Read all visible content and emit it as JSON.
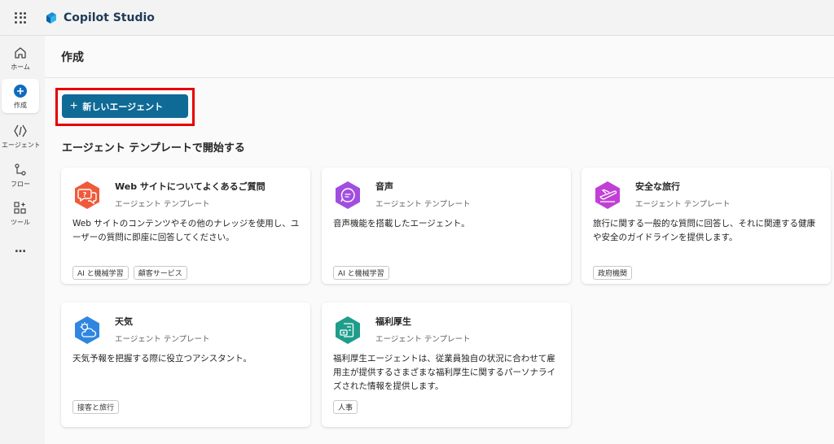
{
  "app": {
    "title": "Copilot Studio"
  },
  "rail": {
    "items": [
      {
        "label": "ホーム",
        "icon": "home-icon"
      },
      {
        "label": "作成",
        "icon": "create-plus-icon",
        "active": true
      },
      {
        "label": "エージェント",
        "icon": "agents-icon"
      },
      {
        "label": "フロー",
        "icon": "flow-icon"
      },
      {
        "label": "ツール",
        "icon": "tools-icon"
      },
      {
        "label": "…",
        "icon": "more-icon"
      }
    ]
  },
  "page": {
    "title": "作成"
  },
  "new_agent_button": {
    "label": "新しいエージェント"
  },
  "section": {
    "title": "エージェント テンプレートで開始する"
  },
  "templates": [
    {
      "title": "Web サイトについてよくあるご質問",
      "subtitle": "エージェント テンプレート",
      "description": "Web サイトのコンテンツやその他のナレッジを使用し、ユーザーの質問に即座に回答してください。",
      "tags": [
        "AI と機械学習",
        "顧客サービス"
      ],
      "icon": "faq-chat-icon",
      "color": "#ef5a3a"
    },
    {
      "title": "音声",
      "subtitle": "エージェント テンプレート",
      "description": "音声機能を搭載したエージェント。",
      "tags": [
        "AI と機械学習"
      ],
      "icon": "voice-chat-icon",
      "color": "#a14ee0"
    },
    {
      "title": "安全な旅行",
      "subtitle": "エージェント テンプレート",
      "description": "旅行に関する一般的な質問に回答し、それに関連する健康や安全のガイドラインを提供します。",
      "tags": [
        "政府機関"
      ],
      "icon": "airplane-icon",
      "color": "#c040d6"
    },
    {
      "title": "天気",
      "subtitle": "エージェント テンプレート",
      "description": "天気予報を把握する際に役立つアシスタント。",
      "tags": [
        "接客と旅行"
      ],
      "icon": "weather-cloud-icon",
      "color": "#2f86e0"
    },
    {
      "title": "福利厚生",
      "subtitle": "エージェント テンプレート",
      "description": "福利厚生エージェントは、従業員独自の状況に合わせて雇用主が提供するさまざまな福利厚生に関するパーソナライズされた情報を提供します。",
      "tags": [
        "人事"
      ],
      "icon": "benefits-icon",
      "color": "#1e9e8a"
    }
  ]
}
